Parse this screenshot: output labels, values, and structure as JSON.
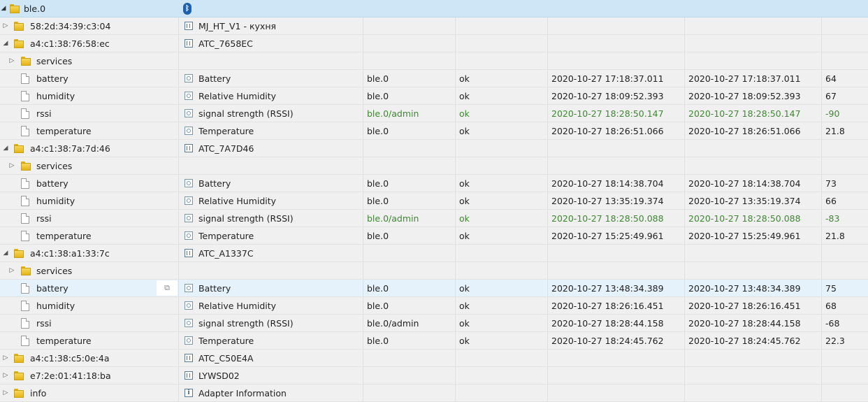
{
  "root": {
    "name": "ble.0",
    "icon": "bluetooth-icon"
  },
  "devices": [
    {
      "id": "58:2d:34:39:c3:04",
      "name": "MJ_HT_V1 - кухня",
      "expanded": false,
      "states": []
    },
    {
      "id": "a4:c1:38:76:58:ec",
      "name": "ATC_7658EC",
      "expanded": true,
      "services_label": "services",
      "states": [
        {
          "id": "battery",
          "name": "Battery",
          "from": "ble.0",
          "quality": "ok",
          "ts": "2020-10-27 17:18:37.011",
          "lc": "2020-10-27 17:18:37.011",
          "val": "64",
          "green": false
        },
        {
          "id": "humidity",
          "name": "Relative Humidity",
          "from": "ble.0",
          "quality": "ok",
          "ts": "2020-10-27 18:09:52.393",
          "lc": "2020-10-27 18:09:52.393",
          "val": "67",
          "green": false
        },
        {
          "id": "rssi",
          "name": "signal strength (RSSI)",
          "from": "ble.0/admin",
          "quality": "ok",
          "ts": "2020-10-27 18:28:50.147",
          "lc": "2020-10-27 18:28:50.147",
          "val": "-90",
          "green": true
        },
        {
          "id": "temperature",
          "name": "Temperature",
          "from": "ble.0",
          "quality": "ok",
          "ts": "2020-10-27 18:26:51.066",
          "lc": "2020-10-27 18:26:51.066",
          "val": "21.8",
          "green": false
        }
      ]
    },
    {
      "id": "a4:c1:38:7a:7d:46",
      "name": "ATC_7A7D46",
      "expanded": true,
      "services_label": "services",
      "states": [
        {
          "id": "battery",
          "name": "Battery",
          "from": "ble.0",
          "quality": "ok",
          "ts": "2020-10-27 18:14:38.704",
          "lc": "2020-10-27 18:14:38.704",
          "val": "73",
          "green": false
        },
        {
          "id": "humidity",
          "name": "Relative Humidity",
          "from": "ble.0",
          "quality": "ok",
          "ts": "2020-10-27 13:35:19.374",
          "lc": "2020-10-27 13:35:19.374",
          "val": "66",
          "green": false
        },
        {
          "id": "rssi",
          "name": "signal strength (RSSI)",
          "from": "ble.0/admin",
          "quality": "ok",
          "ts": "2020-10-27 18:28:50.088",
          "lc": "2020-10-27 18:28:50.088",
          "val": "-83",
          "green": true
        },
        {
          "id": "temperature",
          "name": "Temperature",
          "from": "ble.0",
          "quality": "ok",
          "ts": "2020-10-27 15:25:49.961",
          "lc": "2020-10-27 15:25:49.961",
          "val": "21.8",
          "green": false
        }
      ]
    },
    {
      "id": "a4:c1:38:a1:33:7c",
      "name": "ATC_A1337C",
      "expanded": true,
      "services_label": "services",
      "states": [
        {
          "id": "battery",
          "name": "Battery",
          "from": "ble.0",
          "quality": "ok",
          "ts": "2020-10-27 13:48:34.389",
          "lc": "2020-10-27 13:48:34.389",
          "val": "75",
          "green": false,
          "selected": true
        },
        {
          "id": "humidity",
          "name": "Relative Humidity",
          "from": "ble.0",
          "quality": "ok",
          "ts": "2020-10-27 18:26:16.451",
          "lc": "2020-10-27 18:26:16.451",
          "val": "68",
          "green": false
        },
        {
          "id": "rssi",
          "name": "signal strength (RSSI)",
          "from": "ble.0/admin",
          "quality": "ok",
          "ts": "2020-10-27 18:28:44.158",
          "lc": "2020-10-27 18:28:44.158",
          "val": "-68",
          "green": false
        },
        {
          "id": "temperature",
          "name": "Temperature",
          "from": "ble.0",
          "quality": "ok",
          "ts": "2020-10-27 18:24:45.762",
          "lc": "2020-10-27 18:24:45.762",
          "val": "22.3",
          "green": false
        }
      ]
    },
    {
      "id": "a4:c1:38:c5:0e:4a",
      "name": "ATC_C50E4A",
      "expanded": false,
      "states": []
    },
    {
      "id": "e7:2e:01:41:18:ba",
      "name": "LYWSD02",
      "expanded": false,
      "states": []
    }
  ],
  "info": {
    "id": "info",
    "name": "Adapter Information"
  },
  "colors": {
    "root_row": "#cfe6f6",
    "selected_row": "#e6f2fb",
    "green_text": "#3b8a2e"
  }
}
